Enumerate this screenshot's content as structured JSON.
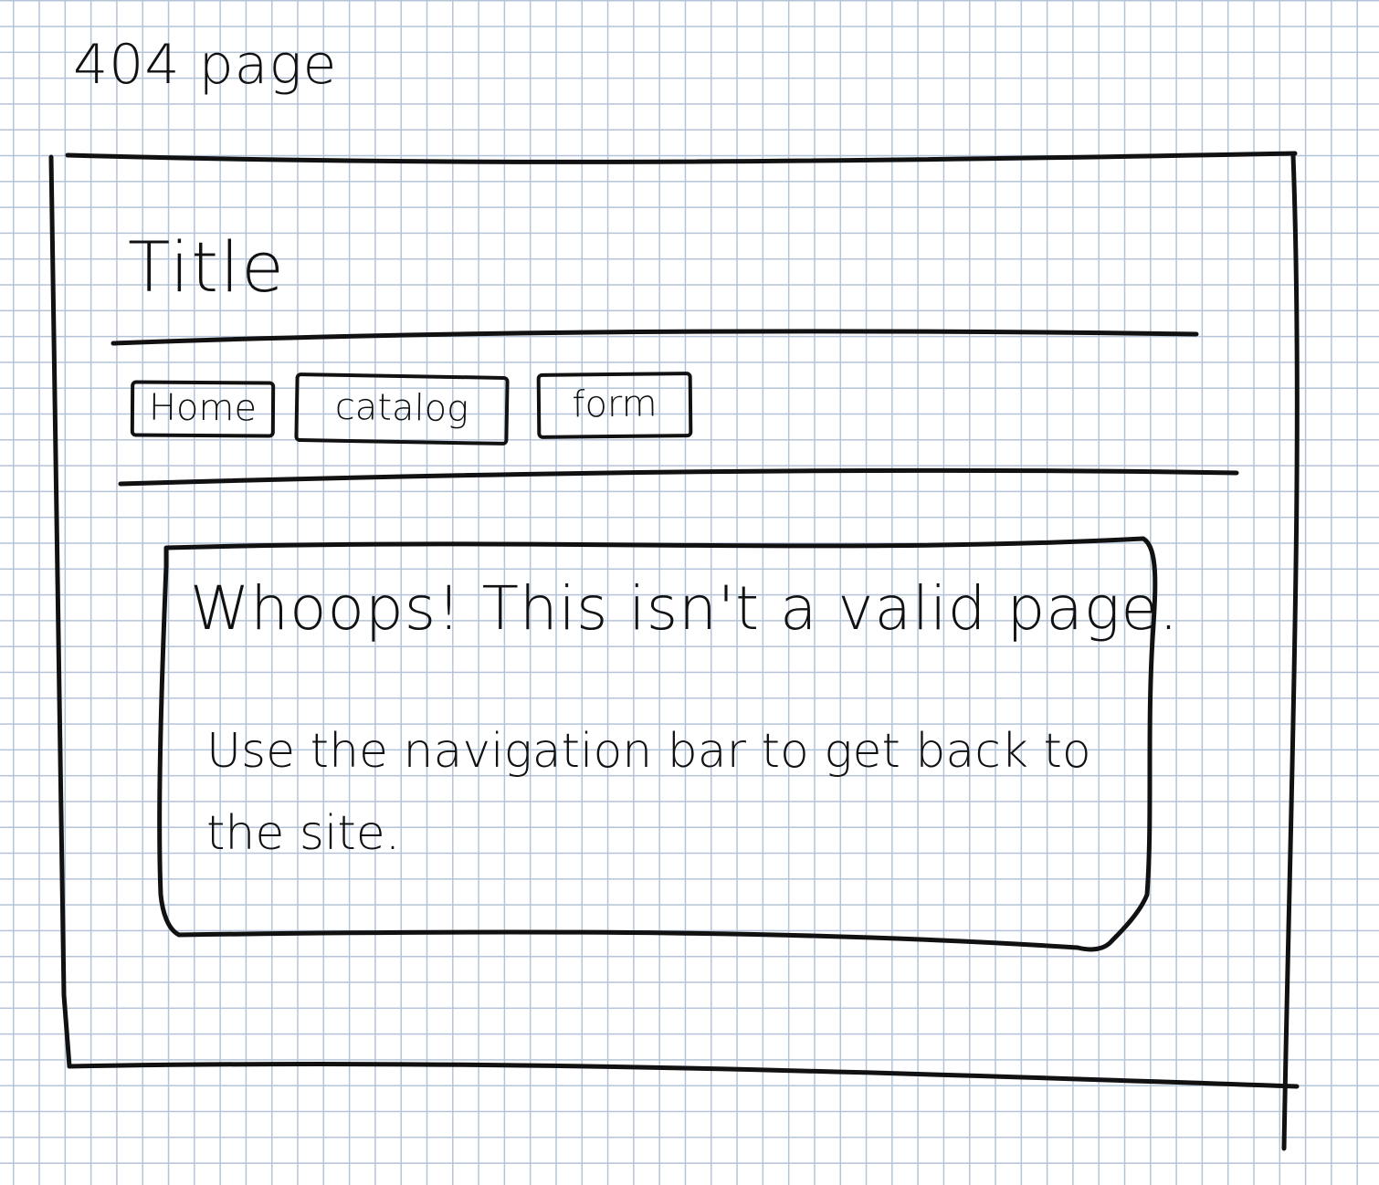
{
  "sketch": {
    "label": "404 page"
  },
  "site": {
    "title": "Title"
  },
  "nav": {
    "items": [
      {
        "label": "Home"
      },
      {
        "label": "catalog"
      },
      {
        "label": "form"
      }
    ]
  },
  "error": {
    "headline": "Whoops! This isn't a valid page.",
    "message": "Use the navigation bar to get back to the site."
  },
  "colors": {
    "ink": "#111111",
    "grid": "#b4c3d8",
    "paper": "#ffffff"
  }
}
